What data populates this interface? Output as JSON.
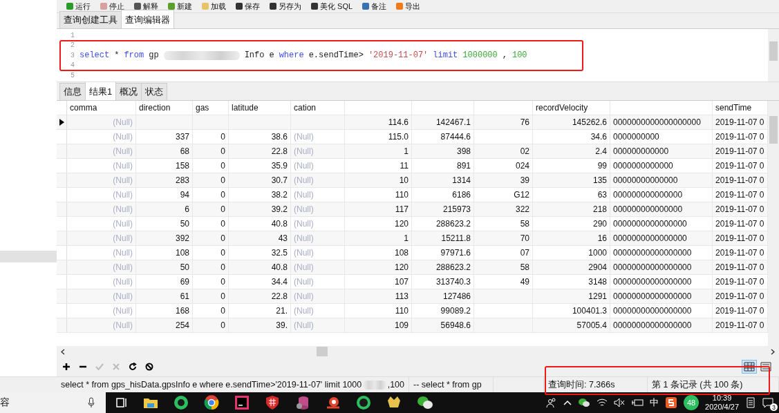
{
  "toolbar": {
    "buttons": [
      {
        "kind": "run",
        "label": "运行"
      },
      {
        "kind": "stop",
        "label": "停止"
      },
      {
        "kind": "explain",
        "label": "解释"
      },
      {
        "kind": "new",
        "label": "新建"
      },
      {
        "kind": "load",
        "label": "加载"
      },
      {
        "kind": "save",
        "label": "保存"
      },
      {
        "kind": "saveas",
        "label": "另存为"
      },
      {
        "kind": "beautify",
        "label": "美化 SQL"
      },
      {
        "kind": "note",
        "label": "备注"
      },
      {
        "kind": "export",
        "label": "导出"
      }
    ]
  },
  "query_tabs": [
    {
      "label": "查询创建工具",
      "selected": false
    },
    {
      "label": "查询编辑器",
      "selected": true
    }
  ],
  "editor": {
    "lines": [
      {
        "number": "1"
      },
      {
        "number": "2"
      },
      {
        "number": "3",
        "tokens": [
          {
            "kind": "keyword",
            "text": "select"
          },
          {
            "kind": "plain",
            "text": "*"
          },
          {
            "kind": "keyword",
            "text": "from"
          },
          {
            "kind": "plain",
            "text": "gp"
          },
          {
            "kind": "redacted"
          },
          {
            "kind": "plain",
            "text": "Info"
          },
          {
            "kind": "plain",
            "text": "e"
          },
          {
            "kind": "keyword",
            "text": "where"
          },
          {
            "kind": "plain",
            "text": "e.sendTime>"
          },
          {
            "kind": "string",
            "text": "'2019-11-07'"
          },
          {
            "kind": "keyword",
            "text": "limit"
          },
          {
            "kind": "number",
            "text": "1000000"
          },
          {
            "kind": "plain",
            "text": ","
          },
          {
            "kind": "number",
            "text": "100"
          }
        ]
      },
      {
        "number": "4"
      },
      {
        "number": "5"
      }
    ]
  },
  "result_tabs": [
    {
      "label": "信息",
      "selected": false
    },
    {
      "label": "结果1",
      "selected": true
    },
    {
      "label": "概况",
      "selected": false
    },
    {
      "label": "状态",
      "selected": false
    }
  ],
  "table": {
    "columns": [
      {
        "label": "comma",
        "kind": "nullnum"
      },
      {
        "label": "direction",
        "kind": "numeric"
      },
      {
        "label": "gas",
        "kind": "numeric"
      },
      {
        "label": "latitude",
        "kind": "numeric"
      },
      {
        "label": "cation",
        "kind": "nulltext"
      },
      {
        "kind": "numeric"
      },
      {
        "kind": "numeric"
      },
      {
        "kind": "numeric"
      },
      {
        "label": "recordVelocity",
        "kind": "numeric"
      },
      {
        "kind": "text"
      },
      {
        "label": "sendTime",
        "kind": "text"
      }
    ],
    "rows": [
      {
        "selected": true,
        "cells": [
          "(Null)",
          "",
          "",
          "",
          "",
          "114.6",
          "142467.1",
          "76",
          "145262.6",
          "0000000000000000000",
          "2019-11-07 0"
        ]
      },
      {
        "selected": false,
        "cells": [
          "(Null)",
          "337",
          "0",
          "38.6",
          "(Null)",
          "115.0",
          "87444.6",
          "",
          "34.6",
          "0000000000",
          "2019-11-07 0"
        ]
      },
      {
        "selected": false,
        "cells": [
          "(Null)",
          "68",
          "0",
          "22.8",
          "(Null)",
          "1",
          "398",
          "02",
          "2.4",
          "000000000000",
          "2019-11-07 0"
        ]
      },
      {
        "selected": false,
        "cells": [
          "(Null)",
          "158",
          "0",
          "35.9",
          "(Null)",
          "11",
          "891",
          "024",
          "99",
          "0000000000000",
          "2019-11-07 0"
        ]
      },
      {
        "selected": false,
        "cells": [
          "(Null)",
          "283",
          "0",
          "30.7",
          "(Null)",
          "10",
          "1314",
          "39",
          "135",
          "00000000000000",
          "2019-11-07 0"
        ]
      },
      {
        "selected": false,
        "cells": [
          "(Null)",
          "94",
          "0",
          "38.2",
          "(Null)",
          "110",
          "6186",
          "G12",
          "63",
          "000000000000000",
          "2019-11-07 0"
        ]
      },
      {
        "selected": false,
        "cells": [
          "(Null)",
          "6",
          "0",
          "39.2",
          "(Null)",
          "117",
          "215973",
          "322",
          "218",
          "000000000000000",
          "2019-11-07 0"
        ]
      },
      {
        "selected": false,
        "cells": [
          "(Null)",
          "50",
          "0",
          "40.8",
          "(Null)",
          "120",
          "288623.2",
          "58",
          "290",
          "0000000000000000",
          "2019-11-07 0"
        ]
      },
      {
        "selected": false,
        "cells": [
          "(Null)",
          "392",
          "0",
          "43",
          "(Null)",
          "1",
          "15211.8",
          "70",
          "16",
          "0000000000000000",
          "2019-11-07 0"
        ]
      },
      {
        "selected": false,
        "cells": [
          "(Null)",
          "108",
          "0",
          "32.5",
          "(Null)",
          "108",
          "97971.6",
          "07",
          "1000",
          "00000000000000000",
          "2019-11-07 0"
        ]
      },
      {
        "selected": false,
        "cells": [
          "(Null)",
          "50",
          "0",
          "40.8",
          "(Null)",
          "120",
          "288623.2",
          "58",
          "2904",
          "00000000000000000",
          "2019-11-07 0"
        ]
      },
      {
        "selected": false,
        "cells": [
          "(Null)",
          "69",
          "0",
          "34.4",
          "(Null)",
          "107",
          "313740.3",
          "49",
          "3148",
          "00000000000000000",
          "2019-11-07 0"
        ]
      },
      {
        "selected": false,
        "cells": [
          "(Null)",
          "61",
          "0",
          "22.8",
          "(Null)",
          "113",
          "127486",
          "",
          "1291",
          "00000000000000000",
          "2019-11-07 0"
        ]
      },
      {
        "selected": false,
        "cells": [
          "(Null)",
          "168",
          "0",
          "21.",
          "(Null)",
          "110",
          "99089.2",
          "",
          "100401.3",
          "00000000000000000",
          "2019-11-07 0"
        ]
      },
      {
        "selected": false,
        "cells": [
          "(Null)",
          "254",
          "0",
          "39.",
          "(Null)",
          "109",
          "56948.6",
          "",
          "57005.4",
          "00000000000000000",
          "2019-11-07 0"
        ]
      }
    ]
  },
  "view_modes": [
    {
      "kind": "grid",
      "selected": true
    },
    {
      "kind": "form",
      "selected": false
    }
  ],
  "status_bar": {
    "sql": "select * from gps_hisData.gpsInfo e where e.sendTime>'2019-11-07' limit 1000",
    "sql_tail": ",100",
    "comment": "-- select * from gp",
    "query_time": "查询时间: 7.366s",
    "record": "第 1 条记录 (共 100 条)"
  },
  "taskbar": {
    "search_text": "容",
    "time": "10:39",
    "date": "2020/4/27",
    "ime": "中",
    "badge": "48",
    "notifications": "3"
  }
}
